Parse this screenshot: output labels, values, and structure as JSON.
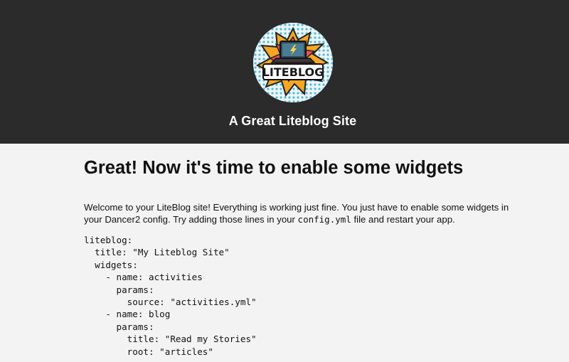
{
  "header": {
    "logo_text": "LITEBLOG",
    "site_title": "A Great Liteblog Site"
  },
  "main": {
    "heading": "Great! Now it's time to enable some widgets",
    "intro_before": "Welcome to your LiteBlog site! Everything is working just fine. You just have to enable some widgets in your Dancer2 config. Try adding those lines in your ",
    "intro_code": "config.yml",
    "intro_after": " file and restart your app.",
    "config_lines": [
      "liteblog:",
      "  title: \"My Liteblog Site\"",
      "  widgets:",
      "    - name: activities",
      "      params:",
      "        source: \"activities.yml\"",
      "    - name: blog",
      "      params:",
      "        title: \"Read my Stories\"",
      "        root: \"articles\""
    ]
  },
  "colors": {
    "header_bg": "#2b2b2b",
    "page_bg": "#f3f3f3",
    "logo_accent": "#f5a623"
  }
}
